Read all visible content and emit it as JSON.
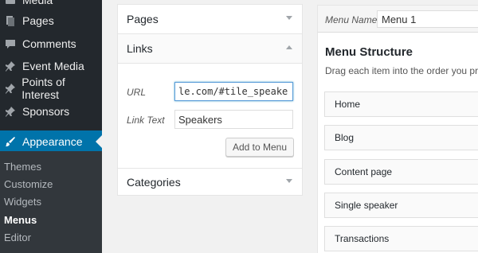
{
  "sidebar": {
    "items": [
      {
        "label": "Media",
        "icon": "media-icon"
      },
      {
        "label": "Pages",
        "icon": "pages-icon"
      },
      {
        "label": "Comments",
        "icon": "comments-icon"
      },
      {
        "label": "Event Media",
        "icon": "pin-icon"
      },
      {
        "label": "Points of Interest",
        "icon": "pin-icon"
      },
      {
        "label": "Sponsors",
        "icon": "pin-icon"
      },
      {
        "label": "Appearance",
        "icon": "brush-icon",
        "current": true
      }
    ],
    "submenu": [
      {
        "label": "Themes"
      },
      {
        "label": "Customize"
      },
      {
        "label": "Widgets"
      },
      {
        "label": "Menus",
        "current": true
      },
      {
        "label": "Editor"
      }
    ]
  },
  "panel": {
    "pages_title": "Pages",
    "links_title": "Links",
    "url_label": "URL",
    "url_value": "le.com/#tile_speakers",
    "link_text_label": "Link Text",
    "link_text_value": "Speakers",
    "add_button": "Add to Menu",
    "categories_title": "Categories"
  },
  "editor": {
    "menu_name_label": "Menu Name",
    "menu_name_value": "Menu 1",
    "structure_title": "Menu Structure",
    "structure_desc": "Drag each item into the order you prefer.",
    "items": [
      {
        "label": "Home"
      },
      {
        "label": "Blog"
      },
      {
        "label": "Content page"
      },
      {
        "label": "Single speaker"
      },
      {
        "label": "Transactions"
      }
    ]
  },
  "colors": {
    "sidebar_bg": "#23282d",
    "accent": "#0073aa",
    "page_bg": "#f1f1f1"
  }
}
